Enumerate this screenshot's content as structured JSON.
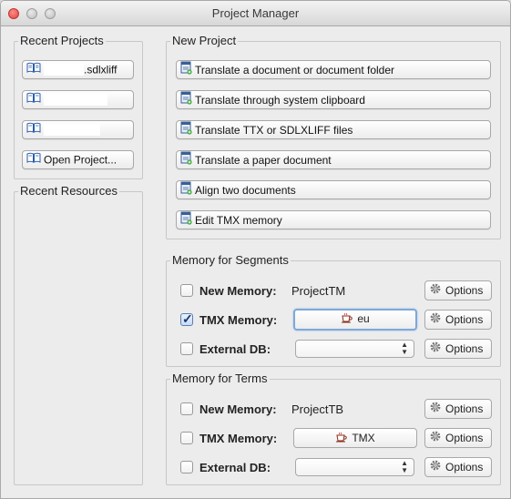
{
  "window": {
    "title": "Project Manager"
  },
  "recent_projects": {
    "title": "Recent Projects",
    "items": [
      {
        "label": ".sdlxliff"
      },
      {
        "label": ""
      },
      {
        "label": ""
      }
    ],
    "open_label": "Open Project..."
  },
  "recent_resources": {
    "title": "Recent Resources"
  },
  "new_project": {
    "title": "New Project",
    "buttons": [
      {
        "label": "Translate a document or document folder"
      },
      {
        "label": "Translate through system clipboard"
      },
      {
        "label": "Translate TTX or SDLXLIFF files"
      },
      {
        "label": "Translate a paper document"
      },
      {
        "label": "Align two documents"
      },
      {
        "label": "Edit TMX memory"
      }
    ]
  },
  "memory_segments": {
    "title": "Memory for Segments",
    "new_memory": {
      "label": "New Memory:",
      "value": "ProjectTM",
      "checked": false
    },
    "tmx_memory": {
      "label": "TMX Memory:",
      "value": "eu",
      "checked": true
    },
    "external_db": {
      "label": "External DB:",
      "value": "",
      "checked": false
    },
    "options_label": "Options"
  },
  "memory_terms": {
    "title": "Memory for Terms",
    "new_memory": {
      "label": "New Memory:",
      "value": "ProjectTB",
      "checked": false
    },
    "tmx_memory": {
      "label": "TMX Memory:",
      "value": "TMX",
      "checked": false
    },
    "external_db": {
      "label": "External DB:",
      "value": "",
      "checked": false
    },
    "options_label": "Options"
  },
  "icons": {
    "book": "book-icon",
    "document": "document-add-icon",
    "coffee": "coffee-cup-icon",
    "gear": "gear-icon"
  },
  "colors": {
    "focus": "#7ea8d8",
    "check": "#16336b",
    "close": "#e0443e"
  }
}
